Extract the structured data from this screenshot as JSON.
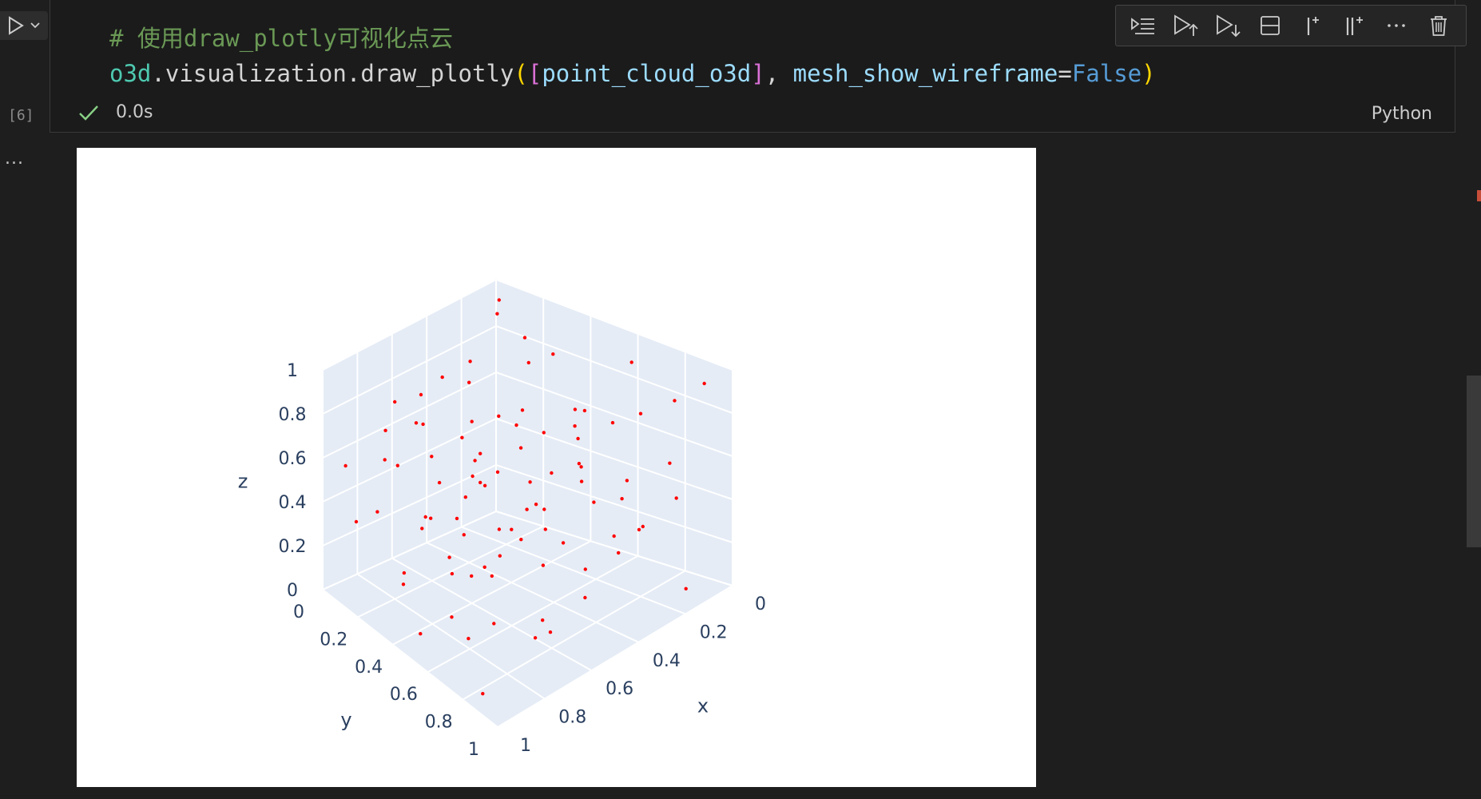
{
  "cell": {
    "execution_count": "[6]",
    "language": "Python",
    "exec_time": "0.0s",
    "code": {
      "comment": "# 使用draw_plotly可视化点云",
      "line2": {
        "var": "o3d",
        "dot1": ".",
        "module": "visualization",
        "dot2": ".",
        "func": "draw_plotly",
        "open_paren": "(",
        "open_bracket": "[",
        "arg": "point_cloud_o3d",
        "close_bracket": "]",
        "comma": ", ",
        "kwarg": "mesh_show_wireframe",
        "eq": "=",
        "value": "False",
        "close_paren": ")"
      }
    },
    "output_more": "..."
  },
  "toolbar": {
    "icons": [
      "execute-above-icon",
      "run-above-icon",
      "run-below-icon",
      "split-cell-icon",
      "add-cell-above-icon",
      "add-cell-below-icon",
      "more-icon",
      "delete-icon"
    ]
  },
  "colors": {
    "point": "#ff0000",
    "pane_fill": "#e5ecf6",
    "grid": "#ffffff",
    "axis_text": "#2a3f5f",
    "success": "#89d185"
  },
  "chart_data": {
    "type": "scatter3d",
    "axes": {
      "x": {
        "label": "x",
        "range": [
          0,
          1
        ],
        "ticks": [
          "0",
          "0.2",
          "0.4",
          "0.6",
          "0.8",
          "1"
        ]
      },
      "y": {
        "label": "y",
        "range": [
          0,
          1
        ],
        "ticks": [
          "0",
          "0.2",
          "0.4",
          "0.6",
          "0.8",
          "1"
        ]
      },
      "z": {
        "label": "z",
        "range": [
          0,
          1
        ],
        "ticks": [
          "0",
          "0.2",
          "0.4",
          "0.6",
          "0.8",
          "1"
        ]
      }
    },
    "grid": true,
    "points": [
      {
        "x": 0.05,
        "y": 0.05,
        "z": 0.95
      },
      {
        "x": 0.1,
        "y": 0.08,
        "z": 0.92
      },
      {
        "x": 0.02,
        "y": 0.9,
        "z": 0.9
      },
      {
        "x": 0.03,
        "y": 0.6,
        "z": 0.88
      },
      {
        "x": 0.1,
        "y": 0.2,
        "z": 0.86
      },
      {
        "x": 0.15,
        "y": 0.9,
        "z": 0.85
      },
      {
        "x": 0.2,
        "y": 0.3,
        "z": 0.82
      },
      {
        "x": 0.25,
        "y": 0.85,
        "z": 0.8
      },
      {
        "x": 0.3,
        "y": 0.12,
        "z": 0.8
      },
      {
        "x": 0.35,
        "y": 0.65,
        "z": 0.78
      },
      {
        "x": 0.4,
        "y": 0.2,
        "z": 0.77
      },
      {
        "x": 0.45,
        "y": 0.5,
        "z": 0.76
      },
      {
        "x": 0.5,
        "y": 0.82,
        "z": 0.75
      },
      {
        "x": 0.55,
        "y": 0.1,
        "z": 0.74
      },
      {
        "x": 0.6,
        "y": 0.4,
        "z": 0.73
      },
      {
        "x": 0.65,
        "y": 0.7,
        "z": 0.72
      },
      {
        "x": 0.7,
        "y": 0.25,
        "z": 0.71
      },
      {
        "x": 0.75,
        "y": 0.6,
        "z": 0.7
      },
      {
        "x": 0.8,
        "y": 0.15,
        "z": 0.69
      },
      {
        "x": 0.85,
        "y": 0.45,
        "z": 0.68
      },
      {
        "x": 0.9,
        "y": 0.8,
        "z": 0.67
      },
      {
        "x": 0.95,
        "y": 0.3,
        "z": 0.66
      },
      {
        "x": 0.12,
        "y": 0.6,
        "z": 0.64
      },
      {
        "x": 0.22,
        "y": 0.95,
        "z": 0.62
      },
      {
        "x": 0.32,
        "y": 0.35,
        "z": 0.61
      },
      {
        "x": 0.42,
        "y": 0.75,
        "z": 0.6
      },
      {
        "x": 0.52,
        "y": 0.05,
        "z": 0.59
      },
      {
        "x": 0.62,
        "y": 0.55,
        "z": 0.58
      },
      {
        "x": 0.72,
        "y": 0.9,
        "z": 0.57
      },
      {
        "x": 0.82,
        "y": 0.6,
        "z": 0.56
      },
      {
        "x": 0.92,
        "y": 0.05,
        "z": 0.55
      },
      {
        "x": 0.08,
        "y": 0.4,
        "z": 0.54
      },
      {
        "x": 0.18,
        "y": 0.15,
        "z": 0.53
      },
      {
        "x": 0.28,
        "y": 0.6,
        "z": 0.52
      },
      {
        "x": 0.38,
        "y": 0.9,
        "z": 0.51
      },
      {
        "x": 0.48,
        "y": 0.3,
        "z": 0.5
      },
      {
        "x": 0.58,
        "y": 0.7,
        "z": 0.49
      },
      {
        "x": 0.68,
        "y": 0.1,
        "z": 0.48
      },
      {
        "x": 0.78,
        "y": 0.85,
        "z": 0.47
      },
      {
        "x": 0.88,
        "y": 0.45,
        "z": 0.46
      },
      {
        "x": 0.06,
        "y": 0.25,
        "z": 0.45
      },
      {
        "x": 0.16,
        "y": 0.7,
        "z": 0.44
      },
      {
        "x": 0.26,
        "y": 0.05,
        "z": 0.43
      },
      {
        "x": 0.36,
        "y": 0.45,
        "z": 0.42
      },
      {
        "x": 0.46,
        "y": 0.95,
        "z": 0.41
      },
      {
        "x": 0.56,
        "y": 0.2,
        "z": 0.4
      },
      {
        "x": 0.66,
        "y": 0.6,
        "z": 0.39
      },
      {
        "x": 0.76,
        "y": 0.35,
        "z": 0.38
      },
      {
        "x": 0.86,
        "y": 0.75,
        "z": 0.37
      },
      {
        "x": 0.96,
        "y": 0.15,
        "z": 0.36
      },
      {
        "x": 0.04,
        "y": 0.8,
        "z": 0.35
      },
      {
        "x": 0.14,
        "y": 0.35,
        "z": 0.34
      },
      {
        "x": 0.24,
        "y": 0.85,
        "z": 0.33
      },
      {
        "x": 0.34,
        "y": 0.2,
        "z": 0.32
      },
      {
        "x": 0.44,
        "y": 0.6,
        "z": 0.31
      },
      {
        "x": 0.54,
        "y": 0.9,
        "z": 0.3
      },
      {
        "x": 0.64,
        "y": 0.4,
        "z": 0.29
      },
      {
        "x": 0.74,
        "y": 0.05,
        "z": 0.28
      },
      {
        "x": 0.84,
        "y": 0.55,
        "z": 0.27
      },
      {
        "x": 0.94,
        "y": 0.9,
        "z": 0.26
      },
      {
        "x": 0.1,
        "y": 0.5,
        "z": 0.25
      },
      {
        "x": 0.2,
        "y": 0.05,
        "z": 0.24
      },
      {
        "x": 0.3,
        "y": 0.8,
        "z": 0.23
      },
      {
        "x": 0.4,
        "y": 0.4,
        "z": 0.22
      },
      {
        "x": 0.5,
        "y": 0.65,
        "z": 0.21
      },
      {
        "x": 0.6,
        "y": 0.15,
        "z": 0.2
      },
      {
        "x": 0.7,
        "y": 0.5,
        "z": 0.19
      },
      {
        "x": 0.8,
        "y": 0.95,
        "z": 0.18
      },
      {
        "x": 0.9,
        "y": 0.35,
        "z": 0.17
      },
      {
        "x": 0.05,
        "y": 0.65,
        "z": 0.16
      },
      {
        "x": 0.15,
        "y": 0.25,
        "z": 0.15
      },
      {
        "x": 0.25,
        "y": 0.5,
        "z": 0.14
      },
      {
        "x": 0.35,
        "y": 0.1,
        "z": 0.13
      },
      {
        "x": 0.45,
        "y": 0.8,
        "z": 0.12
      },
      {
        "x": 0.55,
        "y": 0.45,
        "z": 0.11
      },
      {
        "x": 0.65,
        "y": 0.85,
        "z": 0.1
      },
      {
        "x": 0.75,
        "y": 0.2,
        "z": 0.09
      },
      {
        "x": 0.85,
        "y": 0.65,
        "z": 0.08
      },
      {
        "x": 0.95,
        "y": 0.5,
        "z": 0.07
      },
      {
        "x": 0.15,
        "y": 0.95,
        "z": 0.06
      },
      {
        "x": 0.35,
        "y": 0.3,
        "z": 0.05
      },
      {
        "x": 0.55,
        "y": 0.7,
        "z": 0.04
      },
      {
        "x": 0.75,
        "y": 0.45,
        "z": 0.03
      },
      {
        "x": 0.95,
        "y": 0.85,
        "z": 0.02
      },
      {
        "x": 0.45,
        "y": 0.15,
        "z": 0.02
      },
      {
        "x": 0.65,
        "y": 0.3,
        "z": 0.9
      },
      {
        "x": 0.3,
        "y": 0.5,
        "z": 0.95
      },
      {
        "x": 0.2,
        "y": 0.55,
        "z": 0.7
      },
      {
        "x": 0.6,
        "y": 0.95,
        "z": 0.65
      },
      {
        "x": 0.85,
        "y": 0.25,
        "z": 0.85
      }
    ]
  }
}
